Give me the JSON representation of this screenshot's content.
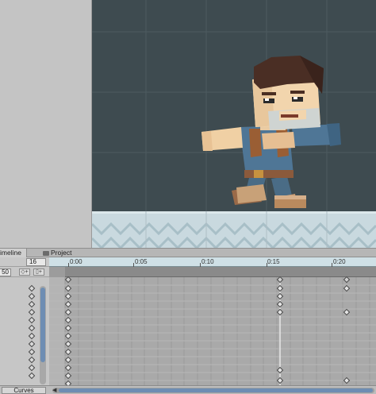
{
  "tabs": {
    "timeline_label": "imeline",
    "project_label": "Project"
  },
  "controls": {
    "frame_value": "16",
    "samples_value": "50",
    "prev_key_icon": "add-keyframe-icon",
    "add_event_icon": "add-event-icon"
  },
  "ruler": {
    "ticks": [
      "0:00",
      "0:05",
      "0:10",
      "0:15",
      "0:20"
    ]
  },
  "bottom": {
    "curves_label": "Curves"
  },
  "colors": {
    "scene_bg": "#3e4b50",
    "ruler_bg": "#cfe0e6",
    "scroll_thumb": "#6e8db3"
  }
}
